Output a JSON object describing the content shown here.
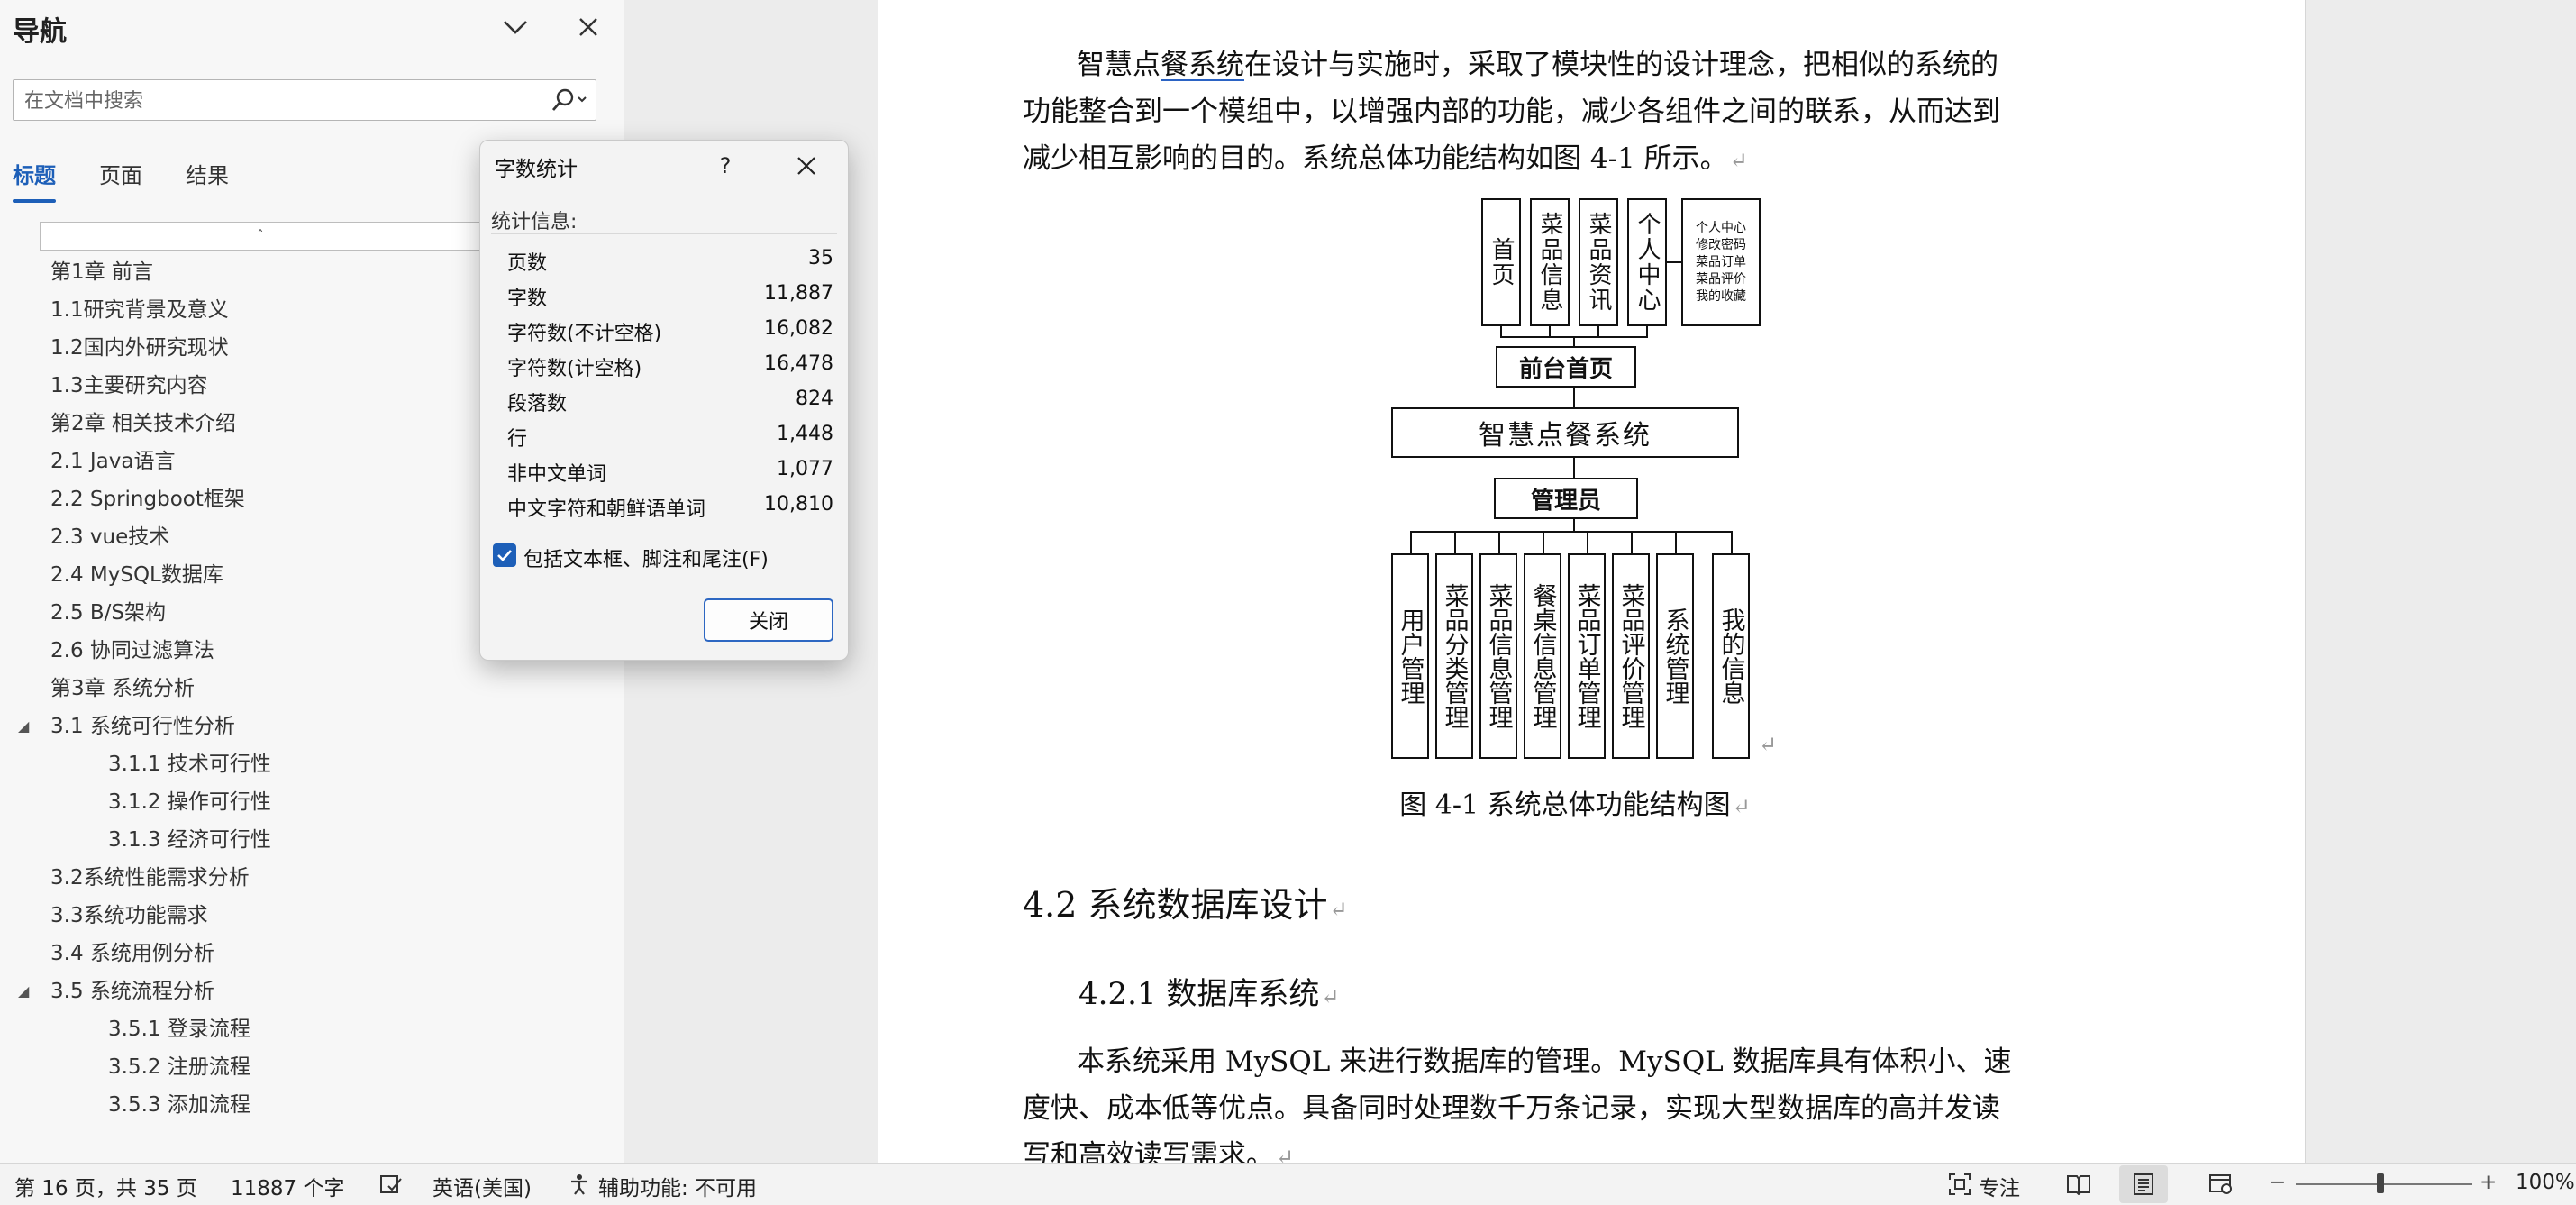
{
  "nav": {
    "title": "导航",
    "search_placeholder": "在文档中搜索",
    "tabs": [
      {
        "label": "标题"
      },
      {
        "label": "页面"
      },
      {
        "label": "结果"
      }
    ],
    "collapse_glyph": "ˆ",
    "headings": [
      {
        "text": "第1章 前言",
        "level": 1
      },
      {
        "text": "1.1研究背景及意义",
        "level": 1
      },
      {
        "text": "1.2国内外研究现状",
        "level": 1
      },
      {
        "text": "1.3主要研究内容",
        "level": 1
      },
      {
        "text": "第2章 相关技术介绍",
        "level": 1
      },
      {
        "text": "2.1 Java语言",
        "level": 1
      },
      {
        "text": "2.2 Springboot框架",
        "level": 1
      },
      {
        "text": "2.3 vue技术",
        "level": 1
      },
      {
        "text": "2.4 MySQL数据库",
        "level": 1
      },
      {
        "text": "2.5 B/S架构",
        "level": 1
      },
      {
        "text": "2.6 协同过滤算法",
        "level": 1
      },
      {
        "text": "第3章 系统分析",
        "level": 1
      },
      {
        "text": "3.1 系统可行性分析",
        "level": 1,
        "expanded": true
      },
      {
        "text": "3.1.1 技术可行性",
        "level": 2
      },
      {
        "text": "3.1.2 操作可行性",
        "level": 2
      },
      {
        "text": "3.1.3 经济可行性",
        "level": 2
      },
      {
        "text": "3.2系统性能需求分析",
        "level": 1
      },
      {
        "text": "3.3系统功能需求",
        "level": 1
      },
      {
        "text": "3.4 系统用例分析",
        "level": 1
      },
      {
        "text": "3.5 系统流程分析",
        "level": 1,
        "expanded": true
      },
      {
        "text": "3.5.1 登录流程",
        "level": 2
      },
      {
        "text": "3.5.2 注册流程",
        "level": 2
      },
      {
        "text": "3.5.3 添加流程",
        "level": 2
      }
    ]
  },
  "document": {
    "para1": {
      "line1_a": "智慧点",
      "line1_u": "餐系统",
      "line1_b": "在设计与实施时，采取了模块性的设计理念，把相似的系统的",
      "line2": "功能整合到一个模组中，以增强内部的功能，减少各组件之间的联系，从而达到",
      "line3": "减少相互影响的目的。系统总体功能结构如图 4-1 所示。"
    },
    "diagram": {
      "front_modules": [
        "首页",
        "菜品信息",
        "菜品资讯",
        "个人中心"
      ],
      "personal_note_lines": [
        "个人中心",
        "修改密码",
        "菜品订单",
        "菜品评价",
        "我的收藏"
      ],
      "front_home": "前台首页",
      "system": "智慧点餐系统",
      "admin": "管理员",
      "admin_modules": [
        "用户管理",
        "菜品分类管理",
        "菜品信息管理",
        "餐桌信息管理",
        "菜品订单管理",
        "菜品评价管理",
        "系统管理",
        "我的信息"
      ]
    },
    "figure_caption": "图 4-1  系统总体功能结构图",
    "section_heading": "4.2  系统数据库设计",
    "subsection_heading": "4.2.1  数据库系统",
    "para2": {
      "line1": "本系统采用 MySQL 来进行数据库的管理。MySQL 数据库具有体积小、速",
      "line2": "度快、成本低等优点。具备同时处理数千万条记录，实现大型数据库的高并发读",
      "line3": "写和高效读写需求。"
    },
    "return_mark": "↵"
  },
  "dialog": {
    "title": "字数统计",
    "help": "?",
    "stats_label": "统计信息:",
    "rows": [
      {
        "label": "页数",
        "value": "35"
      },
      {
        "label": "字数",
        "value": "11,887"
      },
      {
        "label": "字符数(不计空格)",
        "value": "16,082"
      },
      {
        "label": "字符数(计空格)",
        "value": "16,478"
      },
      {
        "label": "段落数",
        "value": "824"
      },
      {
        "label": "行",
        "value": "1,448"
      },
      {
        "label": "非中文单词",
        "value": "1,077"
      },
      {
        "label": "中文字符和朝鲜语单词",
        "value": "10,810"
      }
    ],
    "include_label": "包括文本框、脚注和尾注(F)",
    "include_checked": true,
    "close_label": "关闭"
  },
  "status": {
    "page_info": "第 16 页，共 35 页",
    "word_count": "11887 个字",
    "language": "英语(美国)",
    "accessibility": "辅助功能: 不可用",
    "focus": "专注",
    "zoom": "100%",
    "zoom_minus": "−",
    "zoom_plus": "+"
  },
  "colors": {
    "accent": "#1d5fb8",
    "dialog_bg": "#f3f3f3",
    "page_bg": "#ffffff"
  }
}
